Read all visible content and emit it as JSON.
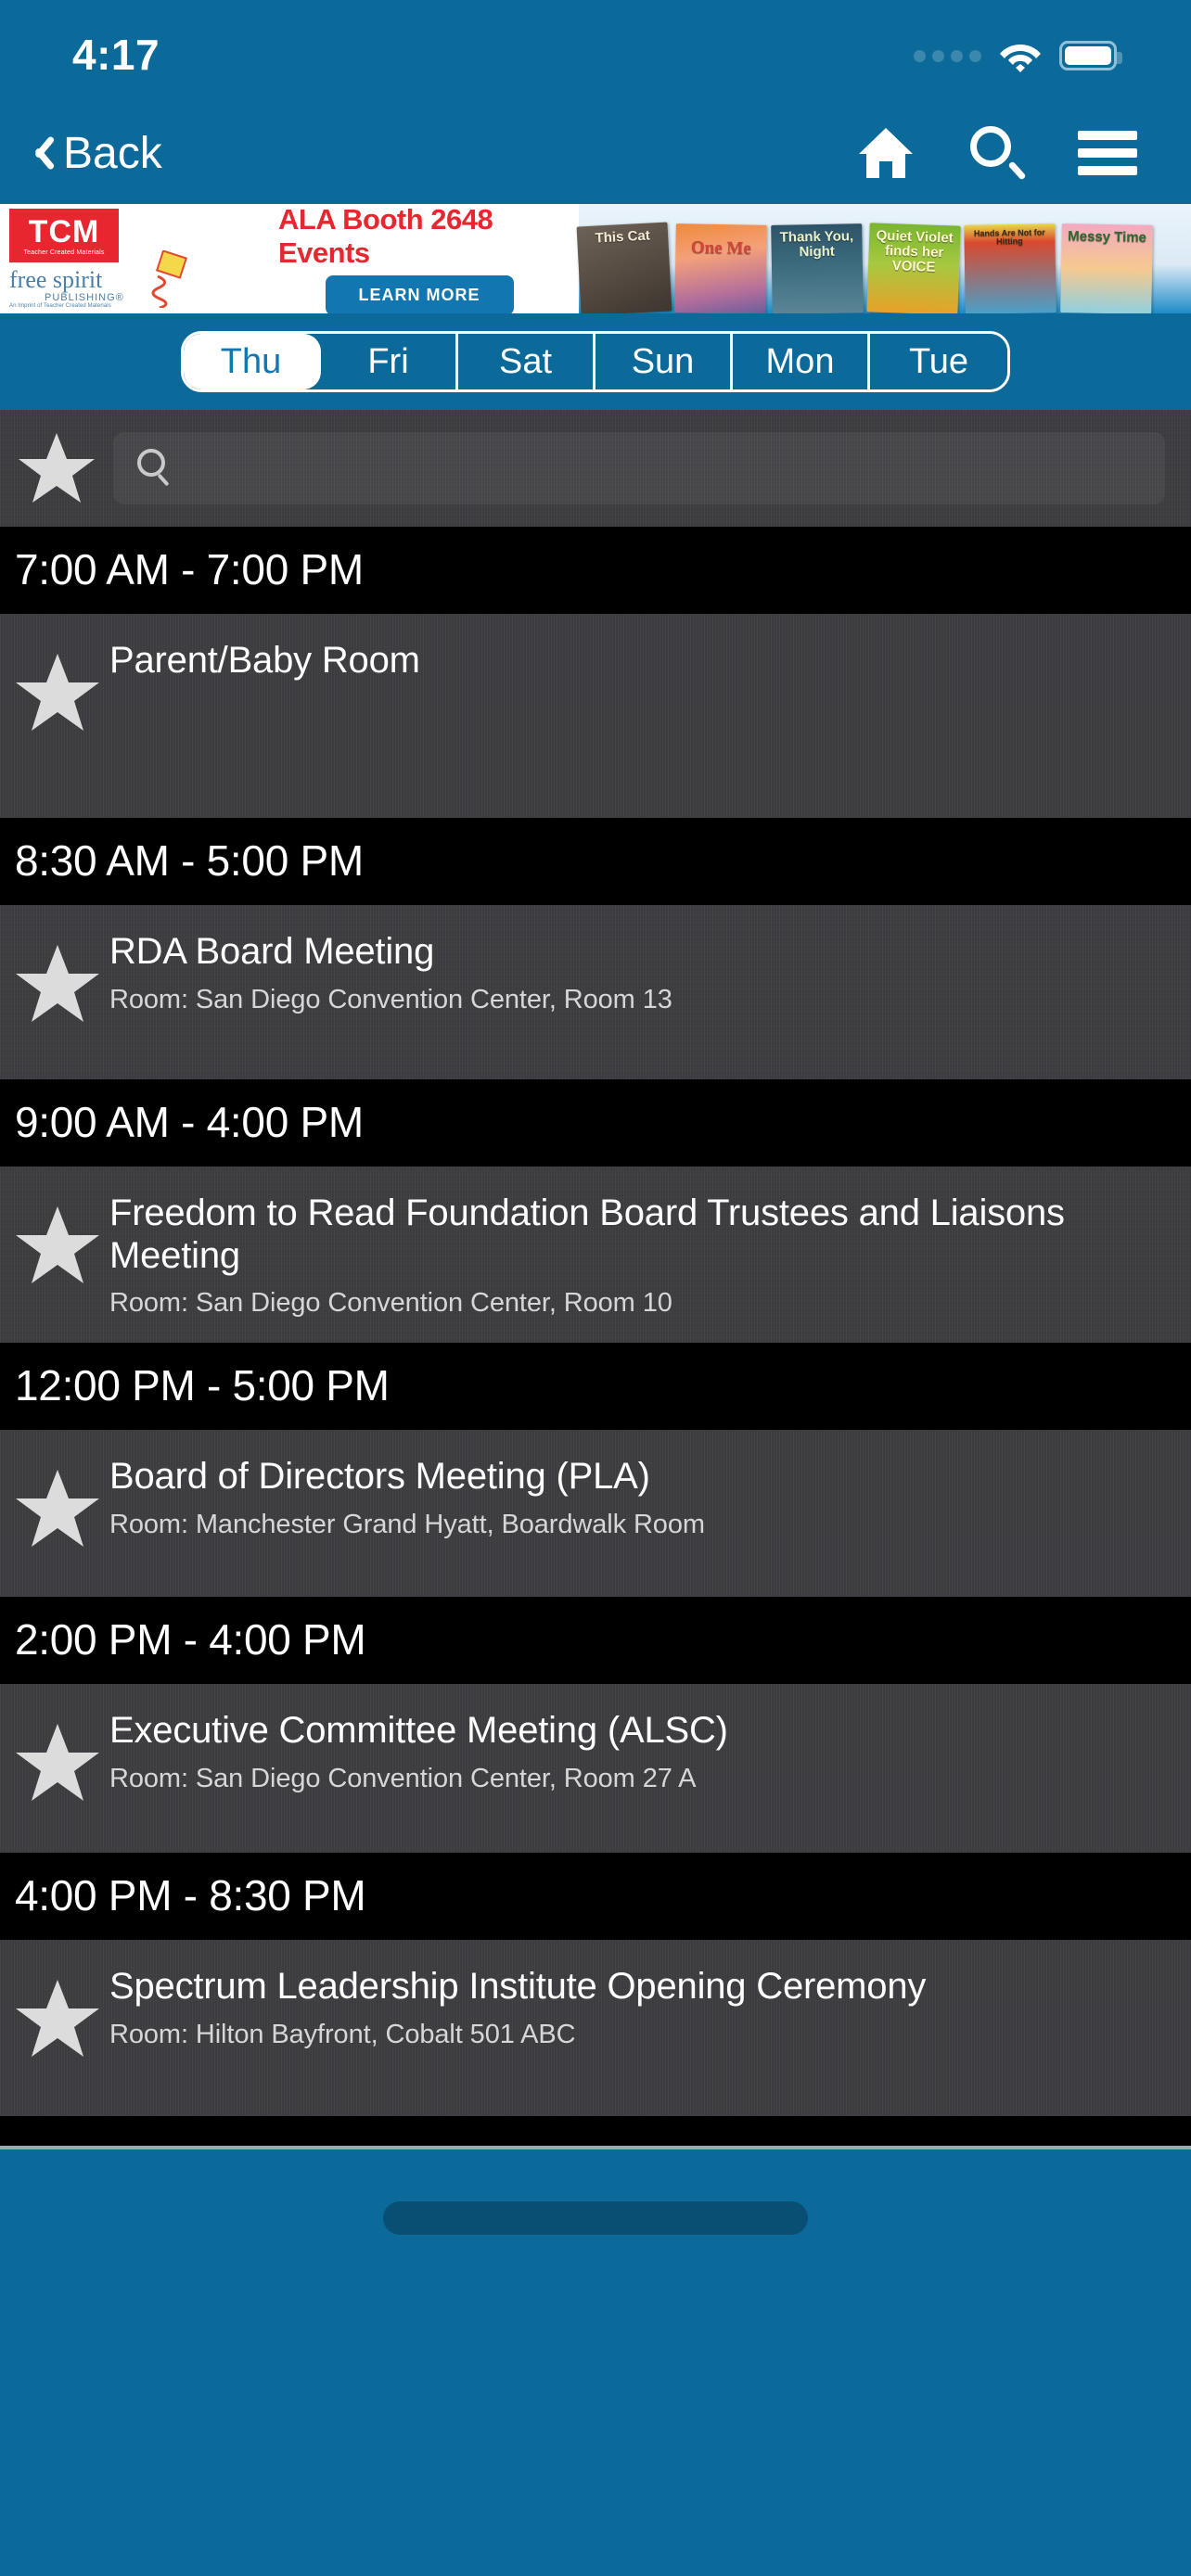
{
  "status_bar": {
    "time": "4:17",
    "signal_icon": "signal-dots-icon",
    "wifi_icon": "wifi-icon",
    "battery_icon": "battery-full-icon"
  },
  "nav": {
    "back_label": "Back",
    "back_icon": "chevron-left-icon",
    "home_icon": "home-icon",
    "search_icon": "search-icon",
    "menu_icon": "hamburger-menu-icon"
  },
  "ad": {
    "brand_main": "TCM",
    "brand_sub": "Teacher Created Materials",
    "imprint_line1": "free spirit",
    "imprint_line2": "PUBLISHING®",
    "imprint_line3": "An Imprint of Teacher Created Materials",
    "headline": "ALA Booth 2648 Events",
    "cta_label": "LEARN MORE",
    "accent_red": "#e8262f",
    "accent_blue": "#1277b0",
    "books": [
      {
        "title": "This Cat"
      },
      {
        "title": "One Me"
      },
      {
        "title": "Thank You, Night"
      },
      {
        "title": "Quiet Violet finds her VOICE"
      },
      {
        "title": "Hands Are Not for Hitting"
      },
      {
        "title": "Messy Time"
      }
    ]
  },
  "day_tabs": {
    "selected": "Thu",
    "items": [
      {
        "label": "Thu",
        "selected": true
      },
      {
        "label": "Fri",
        "selected": false
      },
      {
        "label": "Sat",
        "selected": false
      },
      {
        "label": "Sun",
        "selected": false
      },
      {
        "label": "Mon",
        "selected": false
      },
      {
        "label": "Tue",
        "selected": false
      }
    ]
  },
  "filter_bar": {
    "favorites_icon": "star-icon",
    "search_icon": "search-icon",
    "search_value": "",
    "search_placeholder": ""
  },
  "theme": {
    "header_blue": "#0b6a9a",
    "time_header_bg": "#000000",
    "row_bg": "#3e3e42",
    "title_color": "#ffffff",
    "room_color": "#d6d6d6"
  },
  "schedule": [
    {
      "time": "7:00 AM - 7:00 PM",
      "events": [
        {
          "star_icon": "star-icon",
          "title": "Parent/Baby Room",
          "room": ""
        }
      ]
    },
    {
      "time": "8:30 AM - 5:00 PM",
      "events": [
        {
          "star_icon": "star-icon",
          "title": "RDA Board Meeting",
          "room": "Room: San Diego Convention Center, Room 13"
        }
      ]
    },
    {
      "time": "9:00 AM - 4:00 PM",
      "events": [
        {
          "star_icon": "star-icon",
          "title": "Freedom to Read Foundation Board Trustees and Liaisons Meeting",
          "room": "Room: San Diego Convention Center, Room 10"
        }
      ]
    },
    {
      "time": "12:00 PM - 5:00 PM",
      "events": [
        {
          "star_icon": "star-icon",
          "title": "Board of Directors Meeting (PLA)",
          "room": "Room: Manchester Grand Hyatt, Boardwalk Room"
        }
      ]
    },
    {
      "time": "2:00 PM - 4:00 PM",
      "events": [
        {
          "star_icon": "star-icon",
          "title": "Executive Committee Meeting (ALSC)",
          "room": "Room: San Diego Convention Center, Room 27 A"
        }
      ]
    },
    {
      "time": "4:00 PM - 8:30 PM",
      "events": [
        {
          "star_icon": "star-icon",
          "title": "Spectrum Leadership Institute Opening Ceremony",
          "room": "Room: Hilton Bayfront, Cobalt 501 ABC"
        }
      ]
    }
  ]
}
